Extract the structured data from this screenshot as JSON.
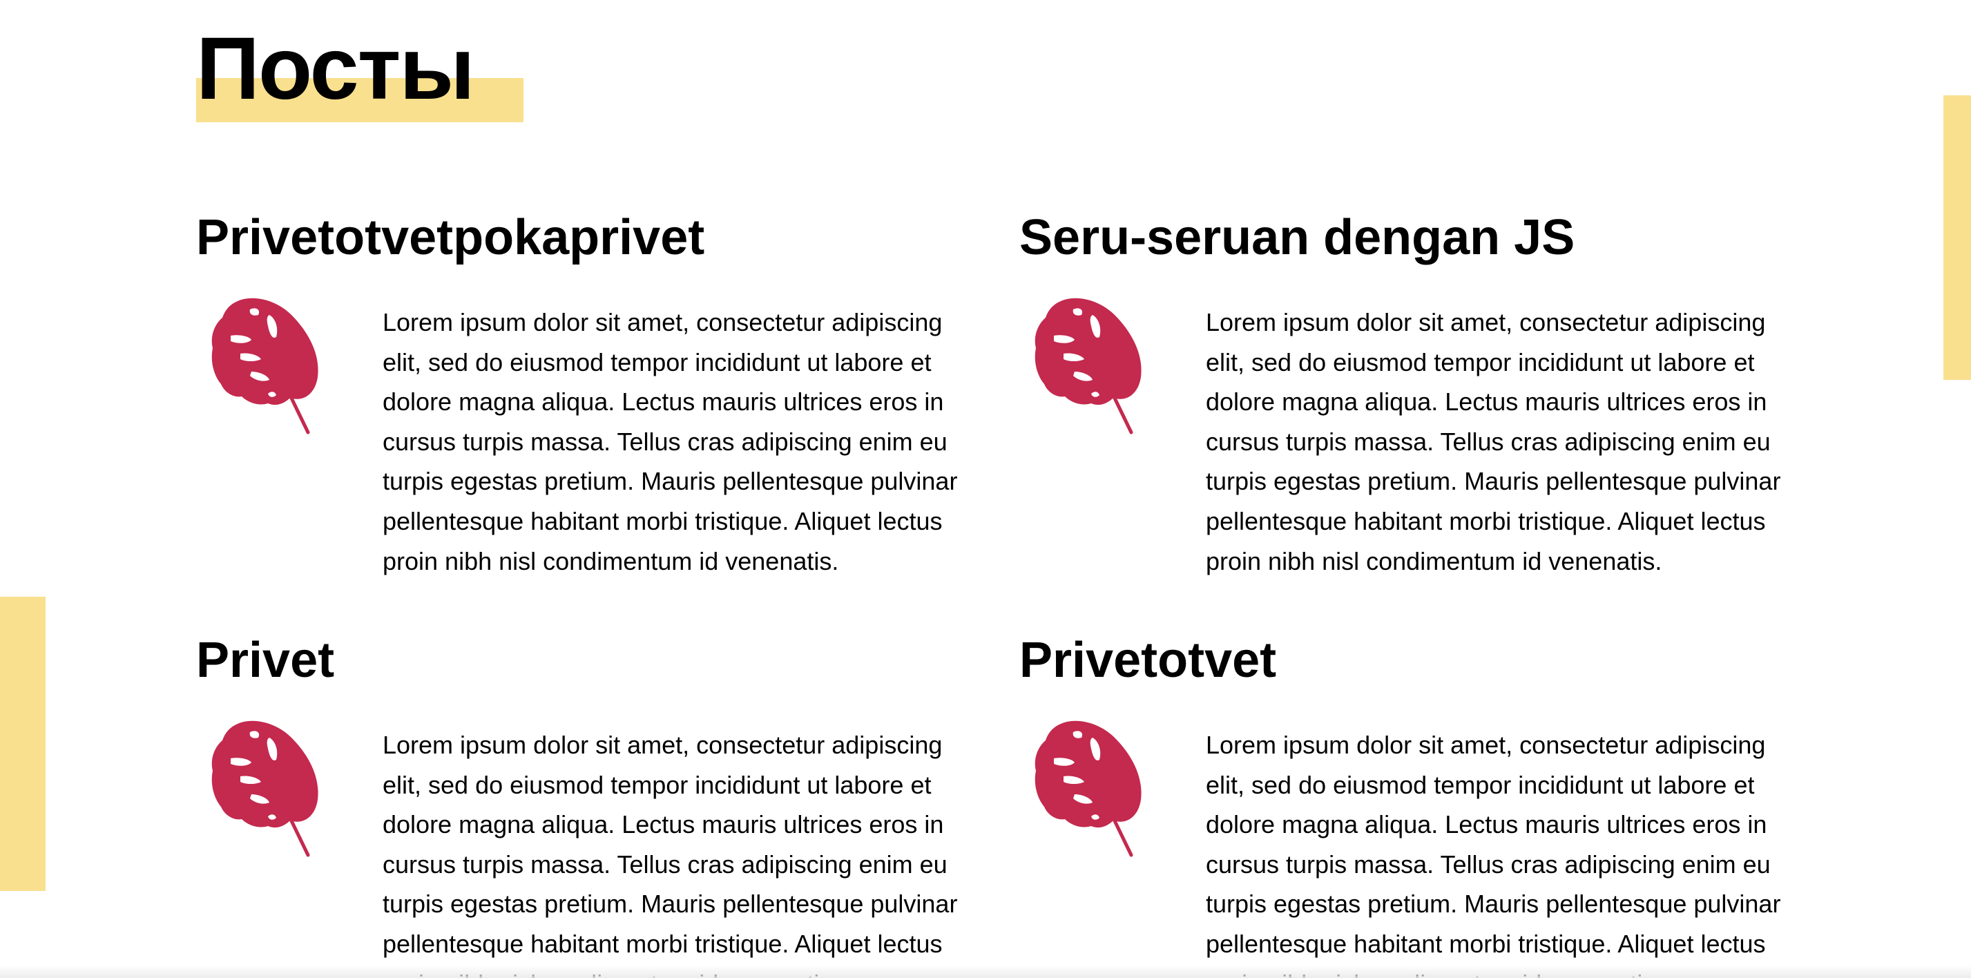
{
  "page": {
    "title": "Посты",
    "accent_color": "#f9e08e",
    "leaf_color": "#c4294e"
  },
  "posts": [
    {
      "title": "Privetotvetpokaprivet",
      "icon": "monstera-leaf-icon",
      "text": "Lorem ipsum dolor sit amet, consectetur adipiscing elit, sed do eiusmod tempor incididunt ut labore et dolore magna aliqua. Lectus mauris ultrices eros in cursus turpis massa. Tellus cras adipiscing enim eu turpis egestas pretium. Mauris pellentesque pulvinar pellentesque habitant morbi tristique. Aliquet lectus proin nibh nisl condimentum id venenatis."
    },
    {
      "title": "Seru-seruan dengan JS",
      "icon": "monstera-leaf-icon",
      "text": "Lorem ipsum dolor sit amet, consectetur adipiscing elit, sed do eiusmod tempor incididunt ut labore et dolore magna aliqua. Lectus mauris ultrices eros in cursus turpis massa. Tellus cras adipiscing enim eu turpis egestas pretium. Mauris pellentesque pulvinar pellentesque habitant morbi tristique. Aliquet lectus proin nibh nisl condimentum id venenatis."
    },
    {
      "title": "Privet",
      "icon": "monstera-leaf-icon",
      "text": "Lorem ipsum dolor sit amet, consectetur adipiscing elit, sed do eiusmod tempor incididunt ut labore et dolore magna aliqua. Lectus mauris ultrices eros in cursus turpis massa. Tellus cras adipiscing enim eu turpis egestas pretium. Mauris pellentesque pulvinar pellentesque habitant morbi tristique. Aliquet lectus proin nibh nisl condimentum id venenatis."
    },
    {
      "title": "Privetotvet",
      "icon": "monstera-leaf-icon",
      "text": "Lorem ipsum dolor sit amet, consectetur adipiscing elit, sed do eiusmod tempor incididunt ut labore et dolore magna aliqua. Lectus mauris ultrices eros in cursus turpis massa. Tellus cras adipiscing enim eu turpis egestas pretium. Mauris pellentesque pulvinar pellentesque habitant morbi tristique. Aliquet lectus proin nibh nisl condimentum id venenatis."
    }
  ]
}
